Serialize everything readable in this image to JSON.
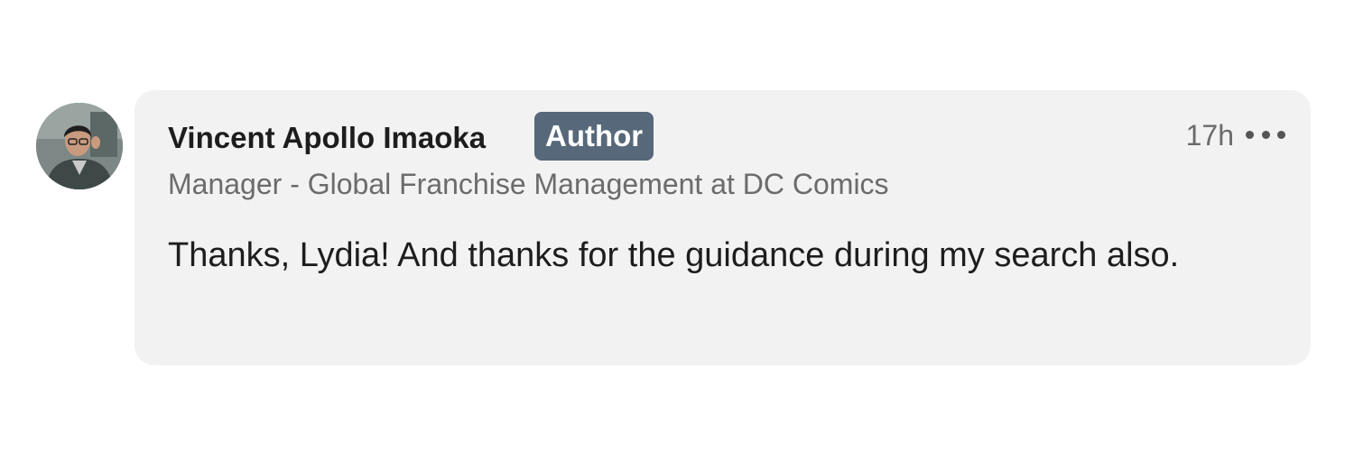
{
  "comment": {
    "author_name": "Vincent Apollo Imaoka",
    "author_badge": "Author",
    "author_headline": "Manager - Global Franchise Management at DC Comics",
    "timestamp": "17h",
    "text": "Thanks, Lydia! And thanks for the guidance during my search also.",
    "more_icon": "ellipsis-icon",
    "avatar_icon": "profile-photo"
  },
  "colors": {
    "bubble_background": "#f2f2f2",
    "badge_background": "#56687a",
    "primary_text": "#1d1d1d",
    "secondary_text": "#6b6b6b"
  }
}
